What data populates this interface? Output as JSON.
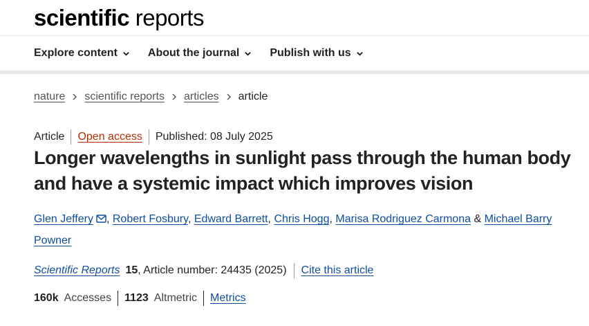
{
  "header": {
    "logo_bold": "scientific",
    "logo_light": "reports"
  },
  "nav": {
    "items": [
      {
        "label": "Explore content"
      },
      {
        "label": "About the journal"
      },
      {
        "label": "Publish with us"
      }
    ]
  },
  "breadcrumb": {
    "items": [
      "nature",
      "scientific reports",
      "articles"
    ],
    "current": "article"
  },
  "article": {
    "type": "Article",
    "access": "Open access",
    "published": "Published: 08 July 2025",
    "title": "Longer wavelengths in sunlight pass through the human body and have a systemic impact which improves vision",
    "authors": {
      "a1": "Glen Jeffery",
      "a2": "Robert Fosbury",
      "a3": "Edward Barrett",
      "a4": "Chris Hogg",
      "a5": "Marisa Rodriguez Carmona",
      "a6": "Michael Barry Powner",
      "comma": ", ",
      "amp": " & "
    },
    "citation": {
      "journal": "Scientific Reports",
      "volume": "15",
      "details": ", Article number: 24435 (2025)",
      "cite_label": "Cite this article"
    },
    "metrics": {
      "accesses_value": "160k",
      "accesses_label": "Accesses",
      "altmetric_value": "1123",
      "altmetric_label": "Altmetric",
      "metrics_link": "Metrics"
    }
  },
  "colors": {
    "link": "#0f4ea0",
    "open_access": "#b32d00",
    "nav_border": "#e3e8ed"
  },
  "icons": {
    "nav_chevron": "chevron-down-icon",
    "breadcrumb_sep": "chevron-right-icon",
    "corresponding": "mail-icon"
  }
}
